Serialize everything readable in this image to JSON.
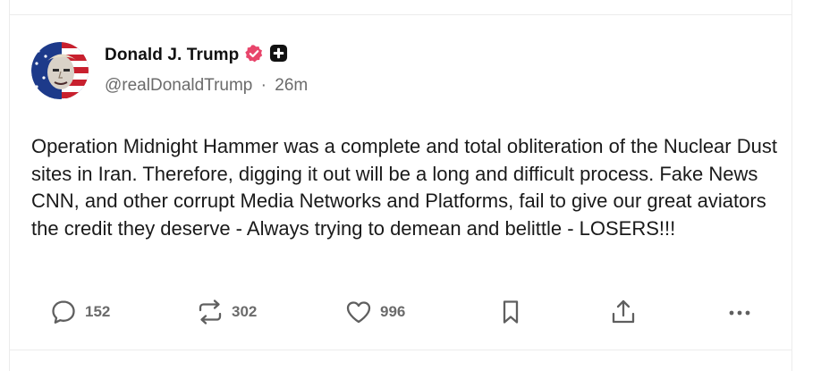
{
  "post": {
    "author": {
      "display_name": "Donald J. Trump",
      "handle": "@realDonaldTrump",
      "time": "26m",
      "separator": "·",
      "verified_icon": "verified-badge-icon",
      "plus_icon": "plus-badge-icon"
    },
    "text": "Operation Midnight Hammer was a complete and total obliteration of the Nuclear Dust sites in Iran. Therefore, digging it out will be a long and difficult process. Fake News CNN, and other corrupt Media Networks and Platforms, fail to give our great aviators the credit they deserve - Always trying to demean and belittle - LOSERS!!!",
    "actions": {
      "replies": "152",
      "reposts": "302",
      "likes": "996"
    }
  },
  "colors": {
    "verified_badge": "#e8456b",
    "muted_text": "#6b6b6b",
    "icon": "#5f5f5f"
  }
}
